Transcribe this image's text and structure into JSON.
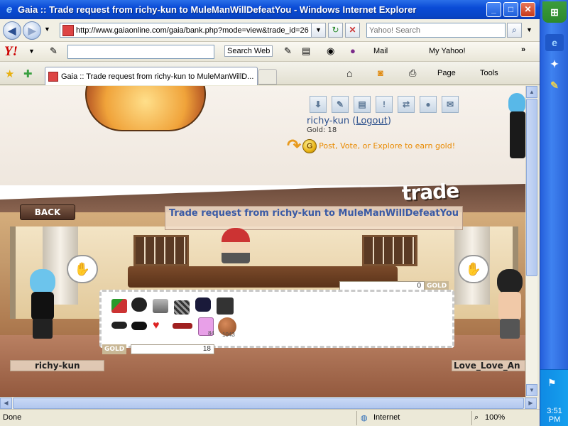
{
  "window": {
    "title": "Gaia :: Trade request from richy-kun to MuleManWillDefeatYou - Windows Internet Explorer",
    "minimize": "_",
    "maximize": "□",
    "close": "✕"
  },
  "addressbar": {
    "url": "http://www.gaiaonline.com/gaia/bank.php?mode=view&trade_id=26",
    "search_placeholder": "Yahoo! Search"
  },
  "yahoo_toolbar": {
    "logo": "Y!",
    "search_button": "Search Web",
    "mail": "Mail",
    "my_yahoo": "My Yahoo!",
    "more": "»"
  },
  "tabs": {
    "active_label": "Gaia :: Trade request from richy-kun to MuleManWillD...",
    "page_menu": "Page",
    "tools_menu": "Tools"
  },
  "gaia": {
    "username": "richy-kun",
    "logout_label": "Logout",
    "gold_label": "Gold: 18",
    "earn_prompt": "Post, Vote, or Explore to earn gold!",
    "trade_banner": "trade",
    "back_label": "BACK",
    "trade_title": "Trade request from richy-kun to MuleManWillDefeatYou",
    "their_gold_value": "0",
    "gold_tag": "GOLD",
    "my_gold_value": "18",
    "left_player": "richy-kun",
    "right_player": "Love_Love_An",
    "item_badges": [
      "84",
      "1043"
    ]
  },
  "statusbar": {
    "status": "Done",
    "zone": "Internet",
    "zoom": "100%"
  },
  "taskbar": {
    "clock": "3:51 PM"
  }
}
